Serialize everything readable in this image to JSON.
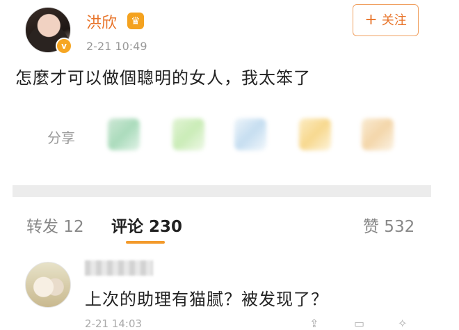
{
  "post": {
    "username": "洪欣",
    "crown_icon": "crown-icon",
    "verified_icon": "verified-badge-icon",
    "timestamp": "2-21 10:49",
    "follow_label": "关注",
    "follow_plus": "+",
    "text": "怎麼才可以做個聰明的女人，我太笨了",
    "share_label": "分享",
    "share_icons": [
      "wechat-icon",
      "moments-icon",
      "qq-icon",
      "qzone-icon",
      "more-share-icon"
    ]
  },
  "tabs": {
    "repost": "转发 12",
    "comments": "评论 230",
    "likes": "赞 532"
  },
  "comment": {
    "text": "上次的助理有猫腻？被发现了？",
    "timestamp": "2-21 14:03",
    "actions": [
      "share-icon",
      "reply-icon",
      "like-icon"
    ]
  },
  "colors": {
    "accent": "#e8742a",
    "tab_underline": "#f39a2b"
  }
}
